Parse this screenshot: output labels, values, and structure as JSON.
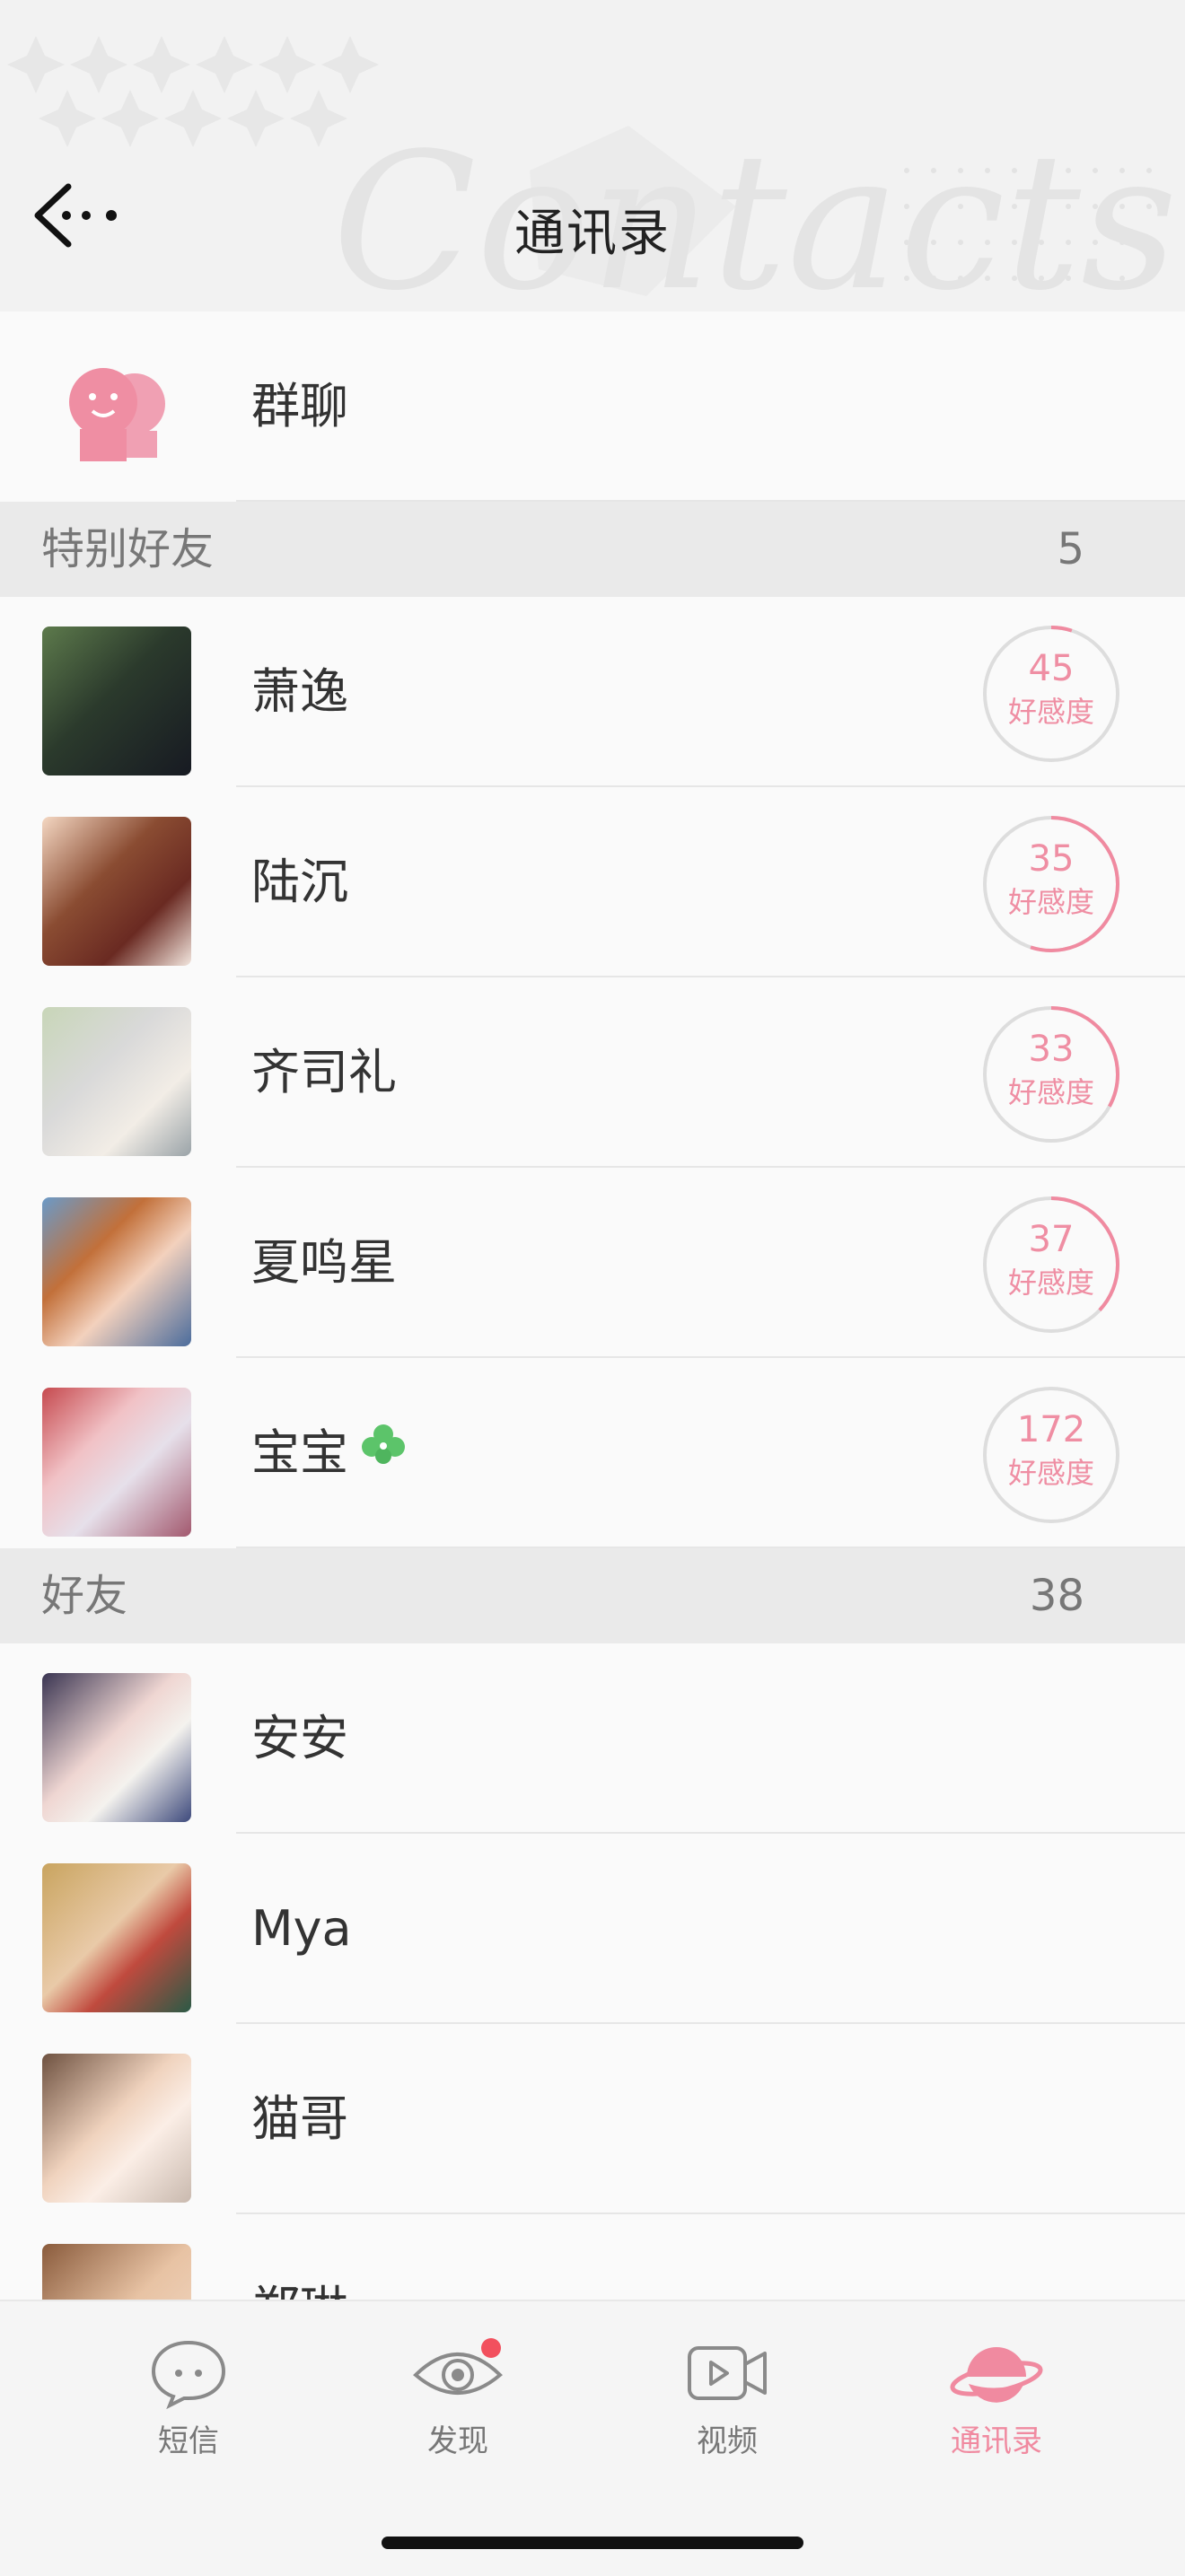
{
  "header": {
    "title": "通讯录",
    "watermark": "Contacts"
  },
  "group_chat": {
    "label": "群聊"
  },
  "sections": [
    {
      "title": "特别好友",
      "count": "5"
    },
    {
      "title": "好友",
      "count": "38"
    }
  ],
  "special_friends": [
    {
      "name": "萧逸",
      "affinity": "45",
      "affinity_label": "好感度",
      "ring_fraction": 0.05
    },
    {
      "name": "陆沉",
      "affinity": "35",
      "affinity_label": "好感度",
      "ring_fraction": 0.55
    },
    {
      "name": "齐司礼",
      "affinity": "33",
      "affinity_label": "好感度",
      "ring_fraction": 0.33
    },
    {
      "name": "夏鸣星",
      "affinity": "37",
      "affinity_label": "好感度",
      "ring_fraction": 0.37
    },
    {
      "name": "宝宝",
      "affinity": "172",
      "affinity_label": "好感度",
      "ring_fraction": 0.0
    }
  ],
  "friends": [
    {
      "name": "安安"
    },
    {
      "name": "Mya"
    },
    {
      "name": "猫哥"
    },
    {
      "name": "郑琳"
    }
  ],
  "tabs": [
    {
      "label": "短信",
      "icon": "chat-bubble-icon"
    },
    {
      "label": "发现",
      "icon": "eye-icon"
    },
    {
      "label": "视频",
      "icon": "video-icon"
    },
    {
      "label": "通讯录",
      "icon": "planet-icon",
      "active": true
    }
  ],
  "colors": {
    "accent": "#f08aa0",
    "ring_track": "#dddddd"
  }
}
